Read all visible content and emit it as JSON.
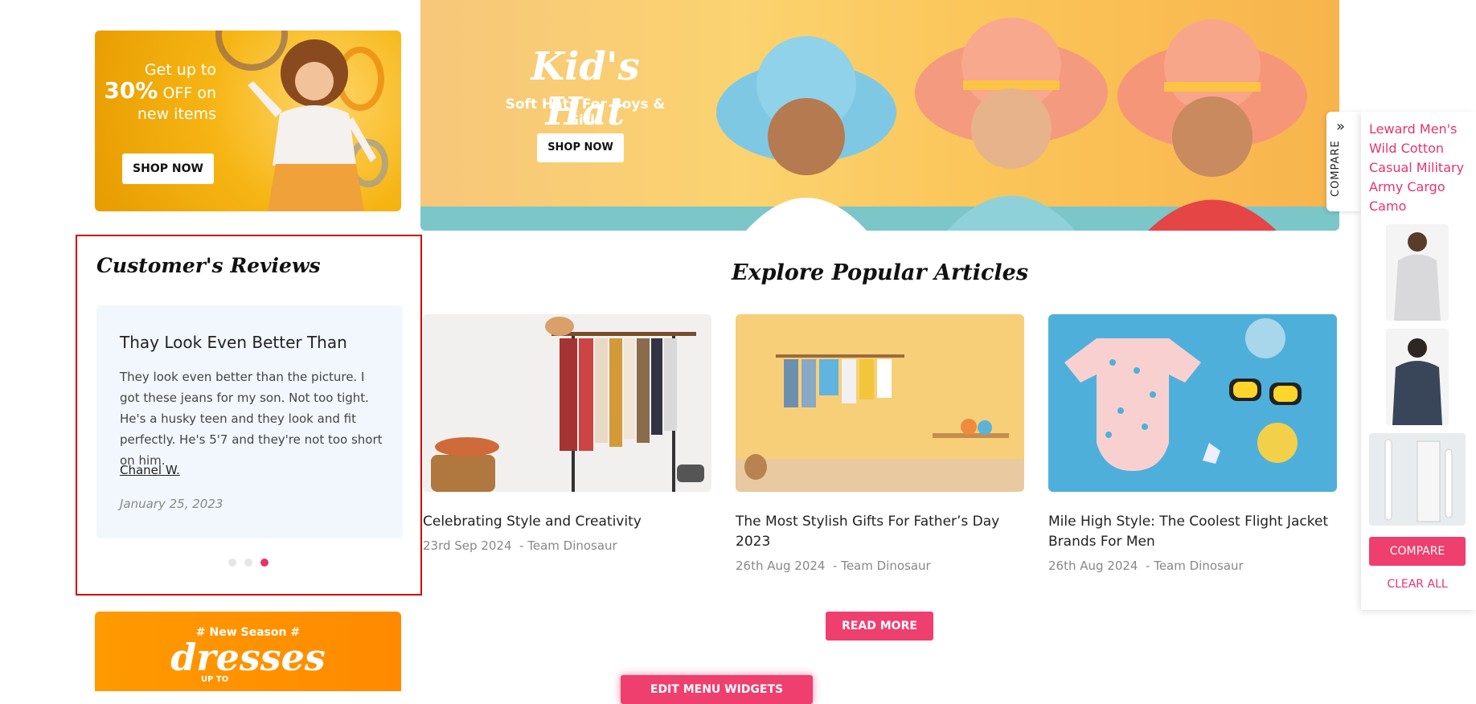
{
  "promo": {
    "line1": "Get up to",
    "percent": "30%",
    "line2": "OFF on",
    "line3": "new items",
    "button": "SHOP NOW"
  },
  "hero": {
    "title": "Kid's Hat",
    "subtitle": "Soft Hats For Boys & Girls",
    "button": "SHOP NOW"
  },
  "reviews": {
    "title": "Customer's Reviews",
    "heading": "Thay Look Even Better Than",
    "body": "They look even better than the picture. I got these jeans for my son. Not too tight. He's a husky teen and they look and fit perfectly. He's 5'7 and they're not too short on him.",
    "author": "Chanel W.",
    "date": "January 25, 2023",
    "active_dot": 3
  },
  "articles": {
    "title": "Explore Popular Articles",
    "items": [
      {
        "title": "Celebrating Style and Creativity",
        "date": "23rd Sep 2024",
        "author": "- Team Dinosaur"
      },
      {
        "title": "The Most Stylish Gifts For Father’s Day 2023",
        "date": "26th Aug 2024",
        "author": "- Team Dinosaur"
      },
      {
        "title": "Mile High Style: The Coolest Flight Jacket Brands For Men",
        "date": "26th Aug 2024",
        "author": "- Team Dinosaur"
      }
    ],
    "read_more": "READ MORE"
  },
  "promo2": {
    "tag": "# New Season #",
    "title": "dresses",
    "upto": "UP TO"
  },
  "edit_button": "EDIT MENU WIDGETS",
  "compare": {
    "tab_label": "COMPARE",
    "broken_alt": "Leward Men's Wild Cotton Casual Military Army Cargo Camo",
    "button": "COMPARE",
    "clear": "CLEAR ALL"
  },
  "colors": {
    "accent": "#ee3f6e",
    "review_bg": "#f1f7fc",
    "highlight_border": "#d40000"
  }
}
